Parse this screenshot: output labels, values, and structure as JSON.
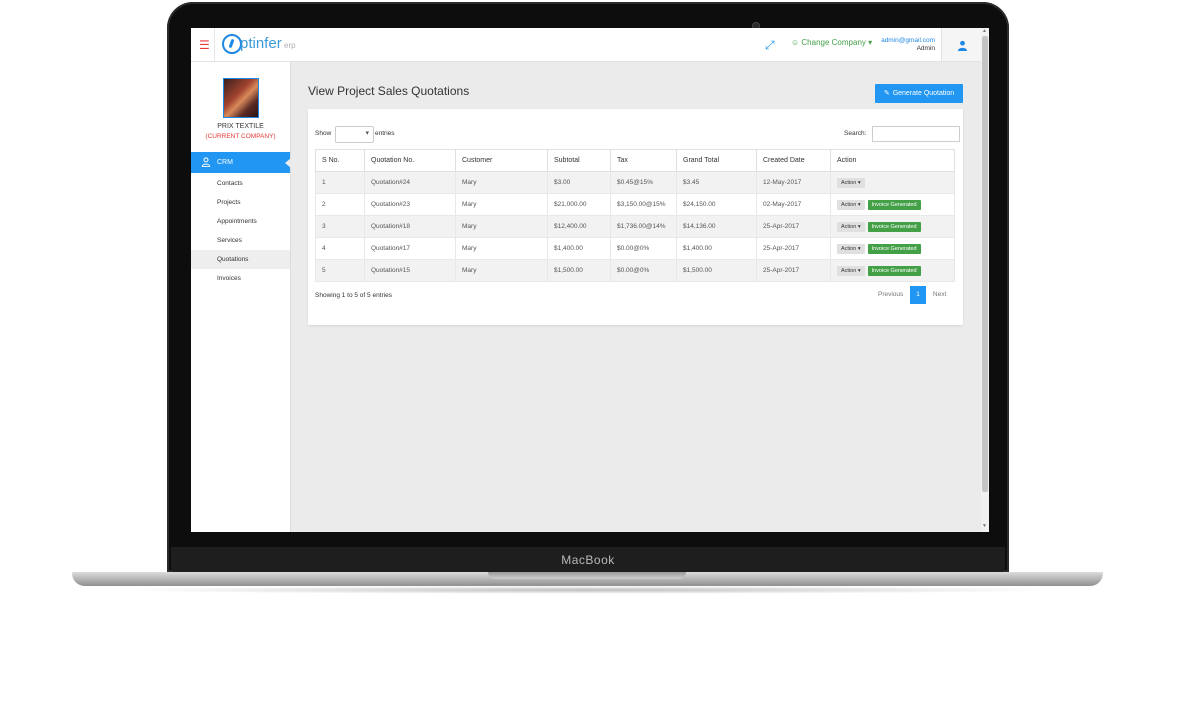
{
  "device": {
    "brand": "MacBook"
  },
  "header": {
    "menu_icon": "hamburger-icon",
    "logo_text": "ptinfer",
    "logo_suffix": "erp",
    "change_company": "Change Company",
    "user_email": "admin@gmail.com",
    "user_role": "Admin",
    "accent_color": "#2196f3"
  },
  "sidebar": {
    "company_name": "PRIX TEXTILE",
    "company_sub": "(CURRENT COMPANY)",
    "module": "CRM",
    "items": [
      {
        "label": "Contacts"
      },
      {
        "label": "Projects"
      },
      {
        "label": "Appointments"
      },
      {
        "label": "Services"
      },
      {
        "label": "Quotations",
        "active": true
      },
      {
        "label": "Invoices"
      }
    ]
  },
  "main": {
    "title": "View Project Sales Quotations",
    "generate_button": "Generate Quotation",
    "show_label": "Show",
    "entries_label": "entries",
    "search_label": "Search:",
    "table": {
      "headers": [
        "S No.",
        "Quotation No.",
        "Customer",
        "Subtotal",
        "Tax",
        "Grand Total",
        "Created Date",
        "Action"
      ],
      "rows": [
        {
          "sno": "1",
          "quotation": "Quotation#24",
          "customer": "Mary",
          "subtotal": "$3.00",
          "tax": "$0.45@15%",
          "total": "$3.45",
          "date": "12-May-2017",
          "action": "Action",
          "badge": ""
        },
        {
          "sno": "2",
          "quotation": "Quotation#23",
          "customer": "Mary",
          "subtotal": "$21,000.00",
          "tax": "$3,150.00@15%",
          "total": "$24,150.00",
          "date": "02-May-2017",
          "action": "Action",
          "badge": "Invoice Generated"
        },
        {
          "sno": "3",
          "quotation": "Quotation#18",
          "customer": "Mary",
          "subtotal": "$12,400.00",
          "tax": "$1,736.00@14%",
          "total": "$14,136.00",
          "date": "25-Apr-2017",
          "action": "Action",
          "badge": "Invoice Generated"
        },
        {
          "sno": "4",
          "quotation": "Quotation#17",
          "customer": "Mary",
          "subtotal": "$1,400.00",
          "tax": "$0.00@0%",
          "total": "$1,400.00",
          "date": "25-Apr-2017",
          "action": "Action",
          "badge": "Invoice Generated"
        },
        {
          "sno": "5",
          "quotation": "Quotation#15",
          "customer": "Mary",
          "subtotal": "$1,500.00",
          "tax": "$0.00@0%",
          "total": "$1,500.00",
          "date": "25-Apr-2017",
          "action": "Action",
          "badge": "Invoice Generated"
        }
      ]
    },
    "showing": "Showing 1 to 5 of 5 entries",
    "pagination": {
      "previous": "Previous",
      "current": "1",
      "next": "Next"
    }
  }
}
